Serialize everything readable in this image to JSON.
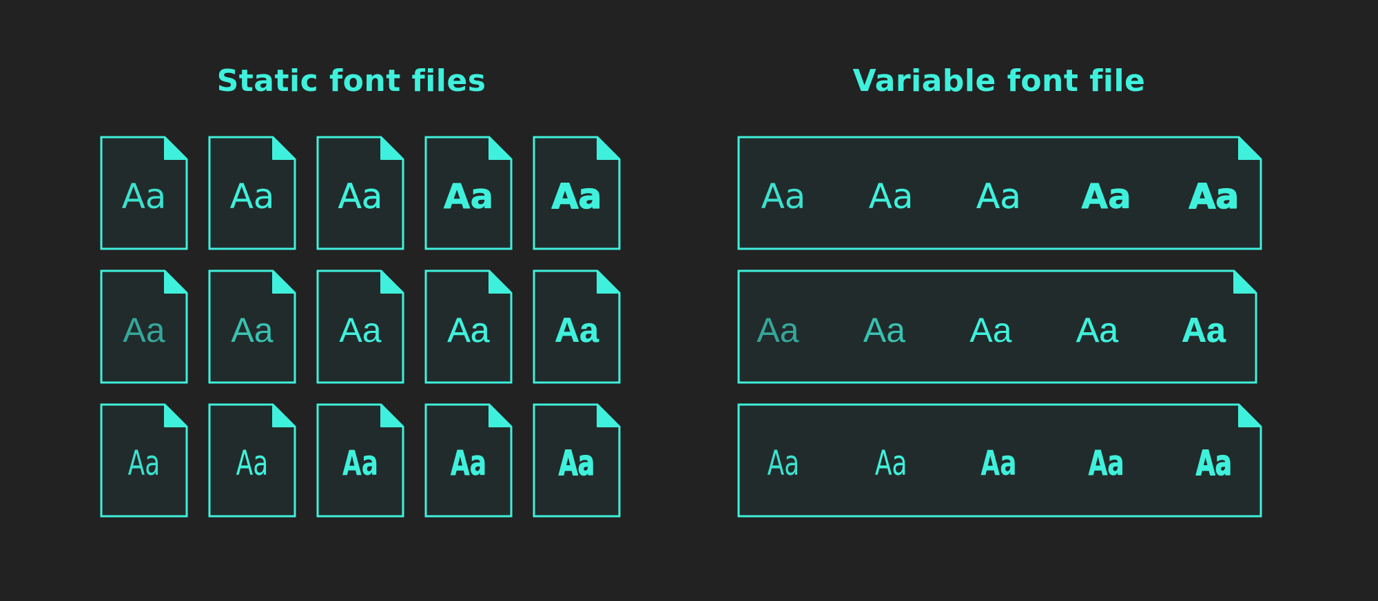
{
  "static_section": {
    "title": "Static font files",
    "rows": [
      {
        "samples": [
          "Aa",
          "Aa",
          "Aa",
          "Aa",
          "Aa"
        ],
        "weights": [
          300,
          400,
          500,
          700,
          900
        ]
      },
      {
        "samples": [
          "Aa",
          "Aa",
          "Aa",
          "Aa",
          "Aa"
        ],
        "weights": [
          100,
          200,
          400,
          500,
          700
        ]
      },
      {
        "samples": [
          "Aa",
          "Aa",
          "Aa",
          "Aa",
          "Aa"
        ],
        "weights": [
          300,
          400,
          600,
          700,
          800
        ]
      }
    ]
  },
  "variable_section": {
    "title": "Variable font file",
    "rows": [
      {
        "samples": [
          "Aa",
          "Aa",
          "Aa",
          "Aa",
          "Aa"
        ],
        "weights": [
          300,
          400,
          500,
          700,
          900
        ]
      },
      {
        "samples": [
          "Aa",
          "Aa",
          "Aa",
          "Aa",
          "Aa"
        ],
        "weights": [
          100,
          200,
          400,
          500,
          700
        ]
      },
      {
        "samples": [
          "Aa",
          "Aa",
          "Aa",
          "Aa",
          "Aa"
        ],
        "weights": [
          300,
          400,
          600,
          700,
          800
        ]
      }
    ]
  },
  "colors": {
    "background": "#222222",
    "accent": "#3ff1dc",
    "file_fill": "#222b2b"
  }
}
